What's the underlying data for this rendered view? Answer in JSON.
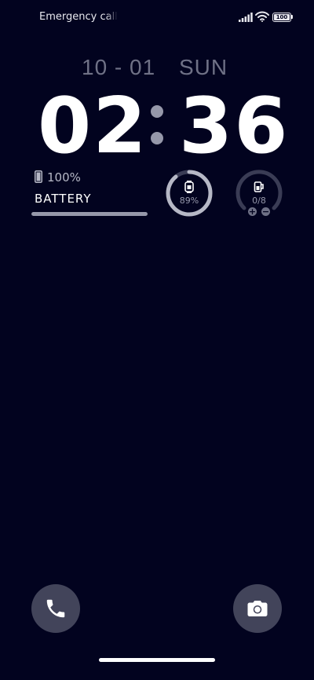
{
  "status_bar": {
    "text": "Emergency calls only",
    "battery_level": "100"
  },
  "lock_screen": {
    "date": "10 - 01",
    "day": "SUN",
    "time_hours": "02",
    "time_minutes": "36"
  },
  "widgets": {
    "phone_battery": {
      "percent_text": "100%",
      "label": "BATTERY",
      "level": 1.0
    },
    "watch_battery": {
      "value_text": "89%",
      "level": 0.89
    },
    "water_tracker": {
      "value_text": "0/8",
      "level": 0.0
    }
  },
  "shortcuts": {
    "phone": "phone-icon",
    "camera": "camera-icon"
  },
  "colors": {
    "background": "#02031f",
    "ring_active": "#b6b8c6",
    "ring_inactive": "#3a3c55",
    "shortcut_bg": "#42445a"
  }
}
